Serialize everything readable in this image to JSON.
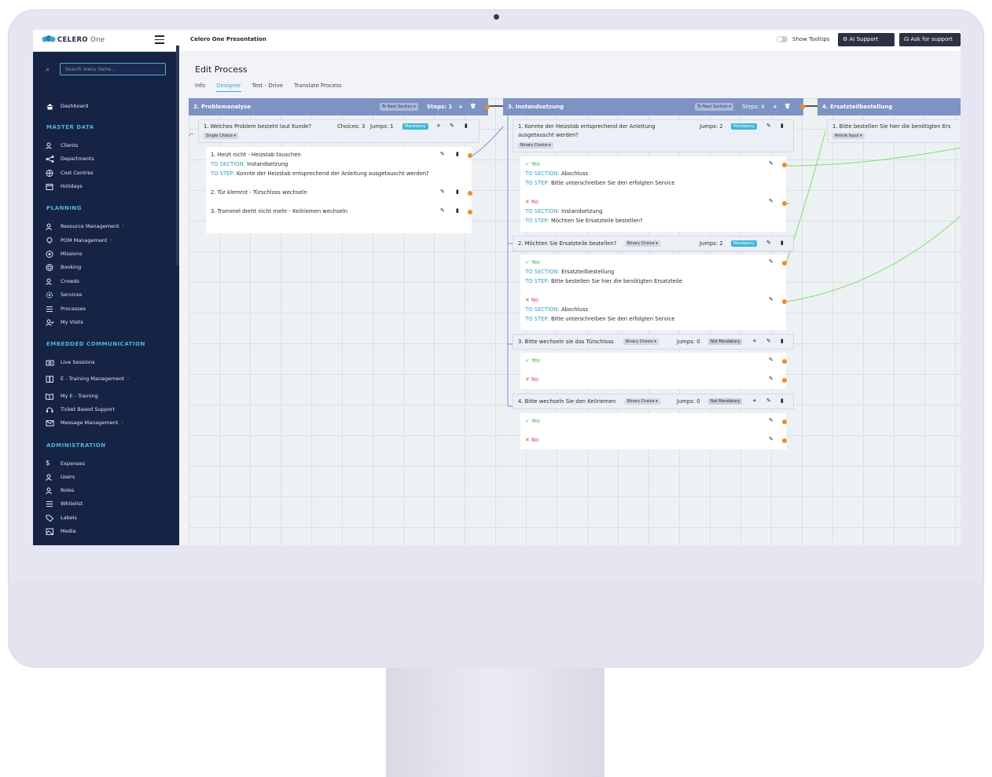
{
  "app": {
    "logo_name": "CELERO",
    "logo_suffix": "One",
    "title": "Celero One Presentation",
    "search_placeholder": "Search menu items...",
    "show_tooltips": "Show Tooltips",
    "ai_support": "AI Support",
    "ask_support": "Ask for support"
  },
  "sidebar": {
    "dashboard": "Dashboard",
    "sections": {
      "master_data": "MASTER DATA",
      "planning": "PLANNING",
      "embedded": "EMBEDDED COMMUNICATION",
      "administration": "ADMINISTRATION"
    },
    "master_data": [
      "Clients",
      "Departments",
      "Cost Centres",
      "Holidays"
    ],
    "planning": [
      "Resource Management",
      "POM Management",
      "Missions",
      "Booking",
      "Crowds",
      "Services",
      "Processes",
      "My Visits"
    ],
    "embedded": [
      "Live Sessions",
      "E - Training Management",
      "My E - Training",
      "Ticket Based Support",
      "Message Management"
    ],
    "administration": [
      "Expenses",
      "Users",
      "Roles",
      "Whitelist",
      "Labels",
      "Media"
    ]
  },
  "page": {
    "title": "Edit Process",
    "tabs": [
      "Info",
      "Designer",
      "Test - Drive",
      "Translate Process"
    ],
    "active_tab": "Designer"
  },
  "designer": {
    "to_next_section": "To Next Section",
    "sections": [
      {
        "title": "2. Problemanalyse",
        "steps": "Steps: 1",
        "step": {
          "title": "1. Welches Problem besteht laut Kunde?",
          "choices": "Choices: 3",
          "jumps": "Jumps: 1",
          "badge": "Mandatory",
          "type": "Single Choice",
          "options": [
            {
              "title": "1. Heizt nicht - Heizstab tauschen",
              "to_section_label": "TO SECTION:",
              "to_section": "Instandsetzung",
              "to_step_label": "TO STEP:",
              "to_step": "Konnte der Heizstab entsprechend der Anleitung ausgetauscht werden?"
            },
            {
              "title": "2. Tür klemmt - Türschloss wechseln"
            },
            {
              "title": "3. Trommel dreht nicht mehr - Keilriemen wechseln"
            }
          ]
        }
      },
      {
        "title": "3. Instandsetzung",
        "steps": "Steps: 4",
        "steps_list": [
          {
            "title": "1. Konnte der Heizstab entsprechend der Anleitung",
            "title2": "ausgetauscht werden?",
            "jumps": "Jumps: 2",
            "badge": "Mandatory",
            "type": "Binary Choice",
            "yes": {
              "label": "Yes",
              "to_section": "Abschluss",
              "to_step": "Bitte unterschreiben Sie den erfolgten Service"
            },
            "no": {
              "label": "No",
              "to_section": "Instandsetzung",
              "to_step": "Möchten Sie Ersatzteile bestellen?"
            }
          },
          {
            "title": "2. Möchten Sie Ersatzteile bestellen?",
            "jumps": "Jumps: 2",
            "badge": "Mandatory",
            "type": "Binary Choice",
            "yes": {
              "label": "Yes",
              "to_section": "Ersatzteilbestellung",
              "to_step": "Bitte bestellen Sie hier die benötigten Ersatzteile"
            },
            "no": {
              "label": "No",
              "to_section": "Abschluss",
              "to_step": "Bitte unterschreiben Sie den erfolgten Service"
            }
          },
          {
            "title": "3. Bitte wechseln sie das Türschloss",
            "jumps": "Jumps: 0",
            "badge": "Not Mandatory",
            "type": "Binary Choice",
            "yes": {
              "label": "Yes"
            },
            "no": {
              "label": "No"
            }
          },
          {
            "title": "4. Bitte wechseln Sie den Keilriemen",
            "jumps": "Jumps: 0",
            "badge": "Not Mandatory",
            "type": "Binary Choice",
            "yes": {
              "label": "Yes"
            },
            "no": {
              "label": "No"
            }
          }
        ]
      },
      {
        "title": "4. Ersatzteilbestellung",
        "step": {
          "title": "1. Bitte bestellen Sie hier die benötigten Ers",
          "type": "Article Input"
        }
      }
    ]
  }
}
